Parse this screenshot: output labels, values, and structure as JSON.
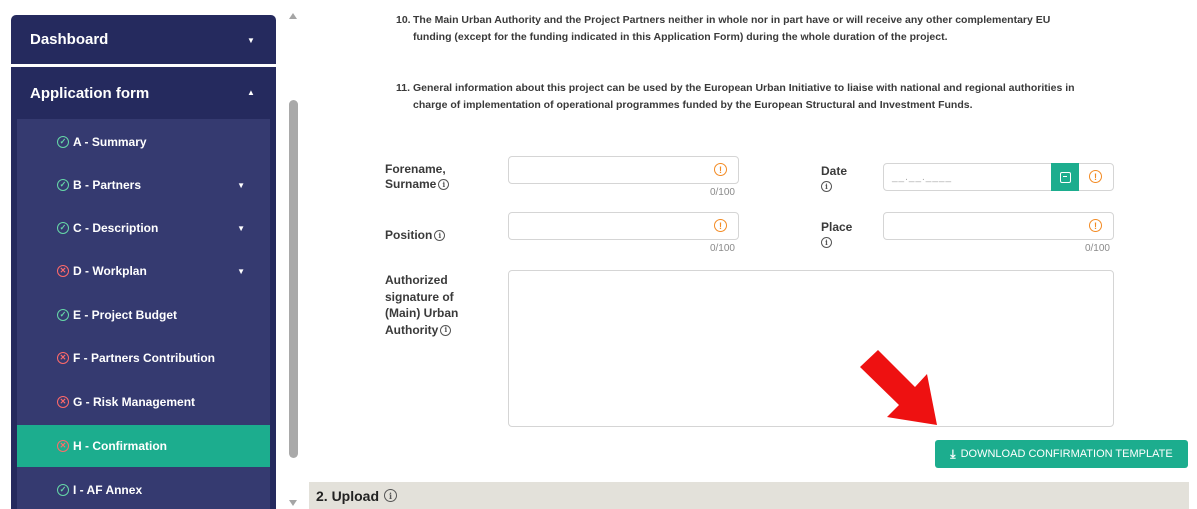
{
  "sidebar": {
    "dashboard_label": "Dashboard",
    "application_form_label": "Application form",
    "items": [
      {
        "label": "A - Summary",
        "status": "ok",
        "expandable": false,
        "active": false
      },
      {
        "label": "B - Partners",
        "status": "ok",
        "expandable": true,
        "active": false
      },
      {
        "label": "C - Description",
        "status": "ok",
        "expandable": true,
        "active": false
      },
      {
        "label": "D - Workplan",
        "status": "error",
        "expandable": true,
        "active": false
      },
      {
        "label": "E - Project Budget",
        "status": "ok",
        "expandable": false,
        "active": false
      },
      {
        "label": "F - Partners Contribution",
        "status": "error",
        "expandable": false,
        "active": false
      },
      {
        "label": "G - Risk Management",
        "status": "error",
        "expandable": false,
        "active": false
      },
      {
        "label": "H - Confirmation",
        "status": "error",
        "expandable": false,
        "active": true
      },
      {
        "label": "I - AF Annex",
        "status": "ok",
        "expandable": false,
        "active": false
      }
    ]
  },
  "content": {
    "para10_num": "10.",
    "para10_text": "The Main Urban Authority and the Project Partners neither in whole nor in part have or will receive any other complementary EU funding (except for the funding indicated in this Application Form) during the whole duration of the project.",
    "para11_num": "11.",
    "para11_text": "General information about this project can be used by the European Urban Initiative to liaise with national and regional authorities in charge of implementation of operational programmes funded by the European Structural and Investment Funds.",
    "fields": {
      "forename_label_1": "Forename,",
      "forename_label_2": "Surname",
      "forename_counter": "0/100",
      "position_label": "Position",
      "position_counter": "0/100",
      "date_label": "Date",
      "date_placeholder": "__.__.____",
      "place_label": "Place",
      "place_counter": "0/100",
      "signature_label_1": "Authorized",
      "signature_label_2": "signature of",
      "signature_label_3": "(Main) Urban",
      "signature_label_4": "Authority"
    },
    "download_button": "DOWNLOAD CONFIRMATION TEMPLATE",
    "upload_section_title": "2. Upload"
  },
  "colors": {
    "sidebar_bg": "#252a5e",
    "submenu_bg": "#353a70",
    "accent_green": "#1cad8e",
    "warning_orange": "#f38b24",
    "arrow_red": "#ee1111"
  },
  "icons": {
    "info": "info-icon",
    "warning": "warning-icon",
    "calendar": "calendar-icon",
    "download": "download-icon",
    "ok": "check-circle-icon",
    "error": "x-circle-icon"
  }
}
